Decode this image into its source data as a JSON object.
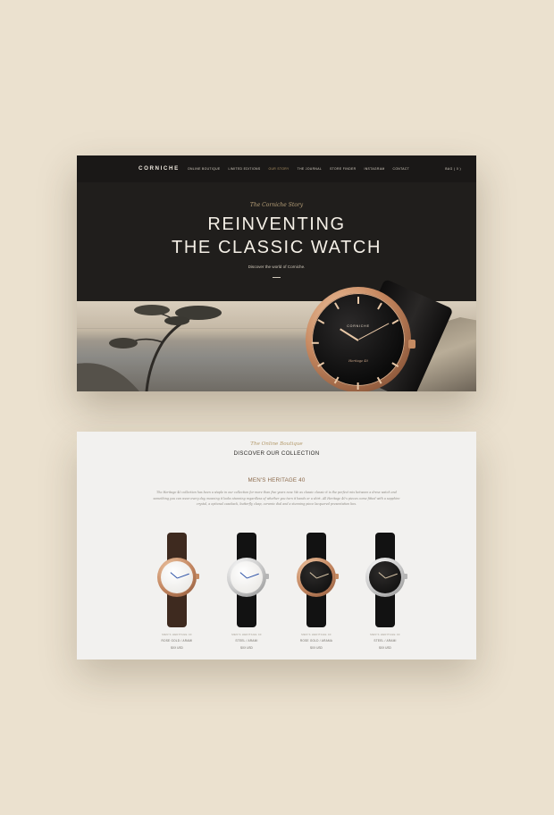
{
  "colors": {
    "background": "#ebe1cf",
    "hero_bg": "#201e1c",
    "accent_gold": "#b99c6b",
    "rose_gold": "#c5875f",
    "collection_bg": "#f2f1ef"
  },
  "nav": {
    "logo": "CORNICHE",
    "links": [
      {
        "label": "ONLINE BOUTIQUE",
        "active": false
      },
      {
        "label": "LIMITED EDITIONS",
        "active": false
      },
      {
        "label": "OUR STORY",
        "active": true
      },
      {
        "label": "THE JOURNAL",
        "active": false
      },
      {
        "label": "STORE FINDER",
        "active": false
      },
      {
        "label": "INSTAGRAM",
        "active": false
      },
      {
        "label": "CONTACT",
        "active": false
      }
    ],
    "bag": "BAG ( 0 )"
  },
  "hero": {
    "tagline": "The Corniche Story",
    "title_line1": "REINVENTING",
    "title_line2": "THE CLASSIC WATCH",
    "subtitle": "Discover the world of Corniche.",
    "watch_brand": "CORNICHE",
    "watch_model": "Heritage 40"
  },
  "collection": {
    "tagline": "The Online Boutique",
    "title": "DISCOVER OUR COLLECTION",
    "heading": "MEN'S HERITAGE 40",
    "description": "The Heritage 40 collection has been a staple in our collection for more than five years now. We as classic classic it is the perfect mix between a dress watch and something you can wear every day, meaning it looks stunning regardless of whether you turn it hands or a shirt. All Heritage 40's pieces come fitted with a sapphire crystal, a optional caseback, butterfly clasp, ceramic dial and a stunning piece lacquered presentation box.",
    "products": [
      {
        "name": "MEN'S HERITAGE 40",
        "material": "ROSE GOLD / ARAMI",
        "price": "$XX USD",
        "case": "rose",
        "dial": "white",
        "strap": "brown"
      },
      {
        "name": "MEN'S HERITAGE 40",
        "material": "STEEL / ARAMI",
        "price": "$XX USD",
        "case": "steel",
        "dial": "white",
        "strap": "black"
      },
      {
        "name": "MEN'S HERITAGE 40",
        "material": "ROSE GOLD / ARAMA",
        "price": "$XX USD",
        "case": "rose",
        "dial": "black",
        "strap": "black"
      },
      {
        "name": "MEN'S HERITAGE 40",
        "material": "STEEL / ARAMI",
        "price": "$XX USD",
        "case": "steel",
        "dial": "black",
        "strap": "black"
      }
    ]
  }
}
